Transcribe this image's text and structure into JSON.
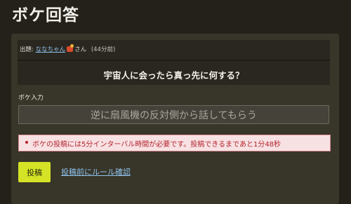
{
  "page": {
    "title": "ボケ回答"
  },
  "question": {
    "prefix": "出題:",
    "user_name": "ななちゃん",
    "badge_icon": "badge-icon",
    "honorific": "さん",
    "time": "(44分前)",
    "text": "宇宙人に会ったら真っ先に何する？"
  },
  "form": {
    "input_label": "ボケ入力",
    "input_value": "逆に扇風機の反対側から話してもらう"
  },
  "error": {
    "message": "ボケの投稿には5分インターバル時間が必要です。投稿できるまであと1分48秒"
  },
  "actions": {
    "submit_label": "投稿",
    "rules_link": "投稿前にルール確認"
  },
  "colors": {
    "background": "#24211a",
    "card": "#383529",
    "accent_button": "#d4e325",
    "link": "#8fc3ee",
    "error_text": "#b3242e",
    "error_bg": "#f8e1e3"
  }
}
